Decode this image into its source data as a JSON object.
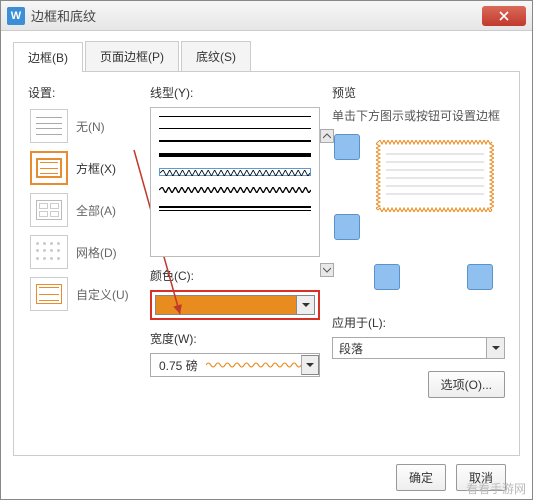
{
  "window": {
    "title": "边框和底纹"
  },
  "tabs": [
    {
      "label": "边框(B)",
      "active": true
    },
    {
      "label": "页面边框(P)",
      "active": false
    },
    {
      "label": "底纹(S)",
      "active": false
    }
  ],
  "settings": {
    "label": "设置:",
    "items": [
      {
        "label": "无(N)",
        "selected": false
      },
      {
        "label": "方框(X)",
        "selected": true
      },
      {
        "label": "全部(A)",
        "selected": false
      },
      {
        "label": "网格(D)",
        "selected": false
      },
      {
        "label": "自定义(U)",
        "selected": false
      }
    ]
  },
  "linetype": {
    "label": "线型(Y):"
  },
  "color": {
    "label": "颜色(C):",
    "value": "#e88c1f"
  },
  "width": {
    "label": "宽度(W):",
    "value": "0.75 磅"
  },
  "preview": {
    "label": "预览",
    "hint": "单击下方图示或按钮可设置边框"
  },
  "apply": {
    "label": "应用于(L):",
    "value": "段落"
  },
  "buttons": {
    "options": "选项(O)...",
    "ok": "确定",
    "cancel": "取消"
  },
  "watermark": "看看手游网"
}
